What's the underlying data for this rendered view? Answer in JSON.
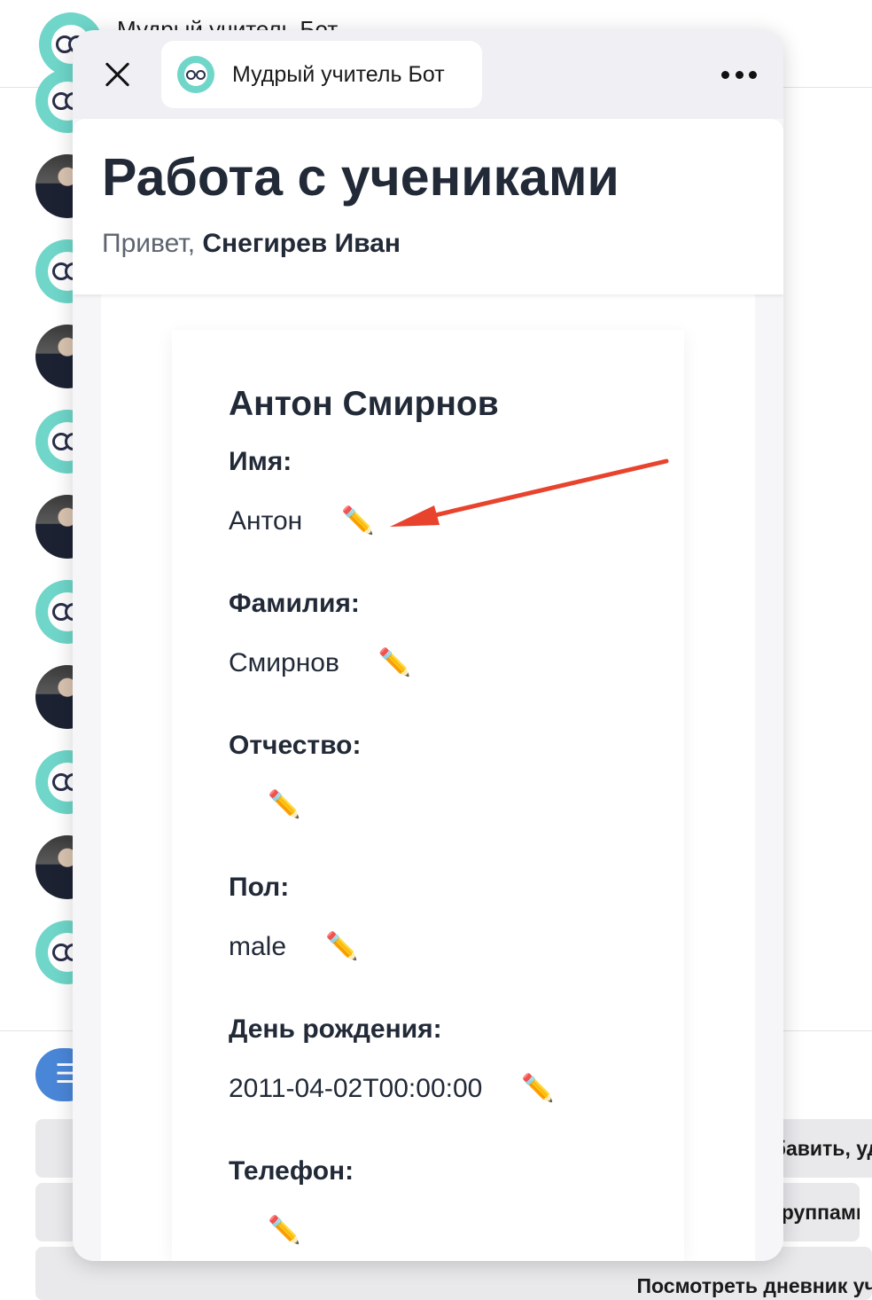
{
  "background_chat": {
    "header_title": "Мудрый учитель Бот",
    "menu_button_icon": "menu-icon",
    "keyboard_buttons": [
      "Добавить, удалить",
      "Управление группами",
      "Посмотреть дневник ученика"
    ]
  },
  "mini_app": {
    "close_icon": "close-icon",
    "bot_name": "Мудрый учитель Бот",
    "more_icon": "more-icon"
  },
  "page": {
    "title": "Работа с учениками",
    "greeting_prefix": "Привет, ",
    "user_name": "Снегирев Иван"
  },
  "student": {
    "full_name": "Антон Смирнов",
    "fields": [
      {
        "label": "Имя:",
        "value": "Антон"
      },
      {
        "label": "Фамилия:",
        "value": "Смирнов"
      },
      {
        "label": "Отчество:",
        "value": ""
      },
      {
        "label": "Пол:",
        "value": "male"
      },
      {
        "label": "День рождения:",
        "value": "2011-04-02T00:00:00"
      },
      {
        "label": "Телефон:",
        "value": ""
      }
    ],
    "edit_icon": "✏️"
  },
  "annotation": {
    "arrow_color": "#e8432d"
  }
}
